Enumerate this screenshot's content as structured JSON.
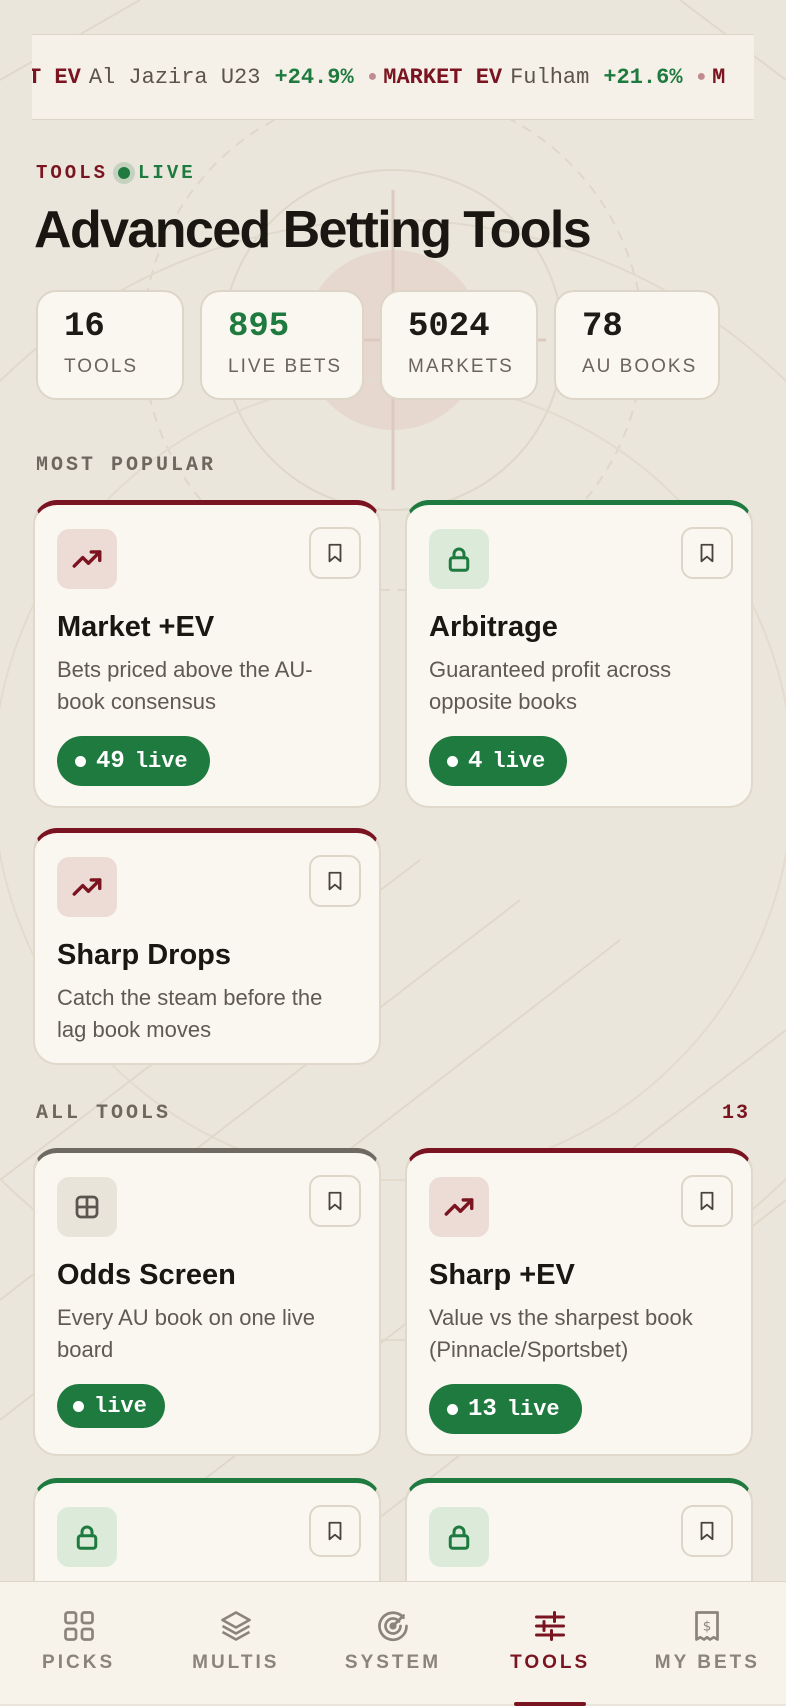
{
  "ticker": [
    {
      "label": "T EV",
      "name": "Al Jazira U23",
      "pct": "+24.9%"
    },
    {
      "label": "MARKET EV",
      "name": "Fulham",
      "pct": "+21.6%"
    },
    {
      "label": "M",
      "name": "",
      "pct": ""
    }
  ],
  "header": {
    "kicker_tools": "TOOLS",
    "kicker_live": "LIVE",
    "title": "Advanced Betting Tools"
  },
  "stats": [
    {
      "value": "16",
      "label": "TOOLS"
    },
    {
      "value": "895",
      "label": "LIVE BETS"
    },
    {
      "value": "5024",
      "label": "MARKETS"
    },
    {
      "value": "78",
      "label": "AU BOOKS"
    }
  ],
  "popular": {
    "label": "MOST POPULAR",
    "cards": [
      {
        "title": "Market +EV",
        "desc": "Bets priced above the AU-book consensus",
        "count": "49",
        "live_text": "live",
        "icon": "trending-up-icon"
      },
      {
        "title": "Arbitrage",
        "desc": "Guaranteed profit across opposite books",
        "count": "4",
        "live_text": "live",
        "icon": "lock-icon"
      },
      {
        "title": "Sharp Drops",
        "desc": "Catch the steam before the lag book moves",
        "icon": "trending-up-icon"
      }
    ]
  },
  "all_tools": {
    "label": "ALL TOOLS",
    "count": "13",
    "cards": [
      {
        "title": "Odds Screen",
        "desc": "Every AU book on one live board",
        "count": "",
        "live_text": "live",
        "icon": "grid-icon"
      },
      {
        "title": "Sharp +EV",
        "desc": "Value vs the sharpest book (Pinnacle/Sportsbet)",
        "count": "13",
        "live_text": "live",
        "icon": "trending-up-icon"
      },
      {
        "icon": "lock-icon"
      },
      {
        "icon": "lock-icon"
      }
    ]
  },
  "nav": [
    {
      "label": "PICKS",
      "icon": "grid-icon"
    },
    {
      "label": "MULTIS",
      "icon": "layers-icon"
    },
    {
      "label": "SYSTEM",
      "icon": "radar-icon"
    },
    {
      "label": "TOOLS",
      "icon": "sliders-icon",
      "active": true
    },
    {
      "label": "MY BETS",
      "icon": "receipt-icon"
    }
  ],
  "colors": {
    "accent": "#7a1420",
    "live_green": "#1e7a3e",
    "background": "#ebe6dc",
    "card": "#faf7f0"
  }
}
